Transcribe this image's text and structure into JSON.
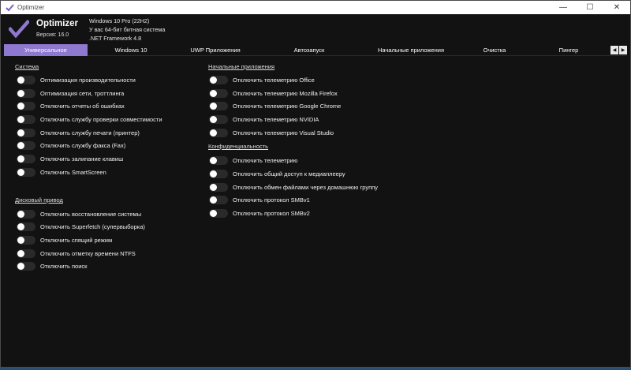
{
  "window": {
    "title": "Optimizer",
    "minimize": "—",
    "maximize": "☐",
    "close": "✕"
  },
  "header": {
    "app_name": "Optimizer",
    "version": "Версия: 16.0",
    "os": "Windows 10 Pro (22H2)",
    "bitness": "У вас 64-бит битная система",
    "framework": ".NET Framework 4.8"
  },
  "tabs": [
    {
      "label": "Универсальное",
      "active": true
    },
    {
      "label": "Windows 10",
      "active": false
    },
    {
      "label": "UWP Приложения",
      "active": false
    },
    {
      "label": "Автозапуск",
      "active": false
    },
    {
      "label": "Начальные приложения",
      "active": false
    },
    {
      "label": "Очистка",
      "active": false
    },
    {
      "label": "Пингер",
      "active": false
    }
  ],
  "tab_arrows": {
    "left": "◀",
    "right": "▶"
  },
  "sections": {
    "system": {
      "title": "Система",
      "options": [
        "Оптимизация производительности",
        "Оптимизация сети, троттлинга",
        "Отключить отчеты об ошибках",
        "Отключить службу проверки совместимости",
        "Отключить службу печати (принтер)",
        "Отключить службу факса (Fax)",
        "Отключить залипание клавиш",
        "Отключить SmartScreen"
      ]
    },
    "disk": {
      "title": "Дисковый привод",
      "options": [
        "Отключить восстановление системы",
        "Отключить Superfetch (супервыборка)",
        "Отключить спящий режим",
        "Отключить отметку времени NTFS",
        "Отключить поиск"
      ]
    },
    "startup_apps": {
      "title": "Начальные приложения",
      "options": [
        "Отключить телеметрию Office",
        "Отключить телеметрию Mozilla Firefox",
        "Отключить телеметрию Google Chrome",
        "Отключить телеметрию NVIDIA",
        "Отключить телеметрию Visual Studio"
      ]
    },
    "privacy": {
      "title": "Конфиденциальность",
      "options": [
        "Отключить телеметрию",
        "Отключить общий доступ к медиаплееру",
        "Отключить обмен файлами через домашнюю группу",
        "Отключить протокол SMBv1",
        "Отключить протокол SMBv2"
      ]
    }
  },
  "colors": {
    "accent": "#8f78d0",
    "background": "#121212",
    "toggle_off": "#2a2a2a"
  }
}
